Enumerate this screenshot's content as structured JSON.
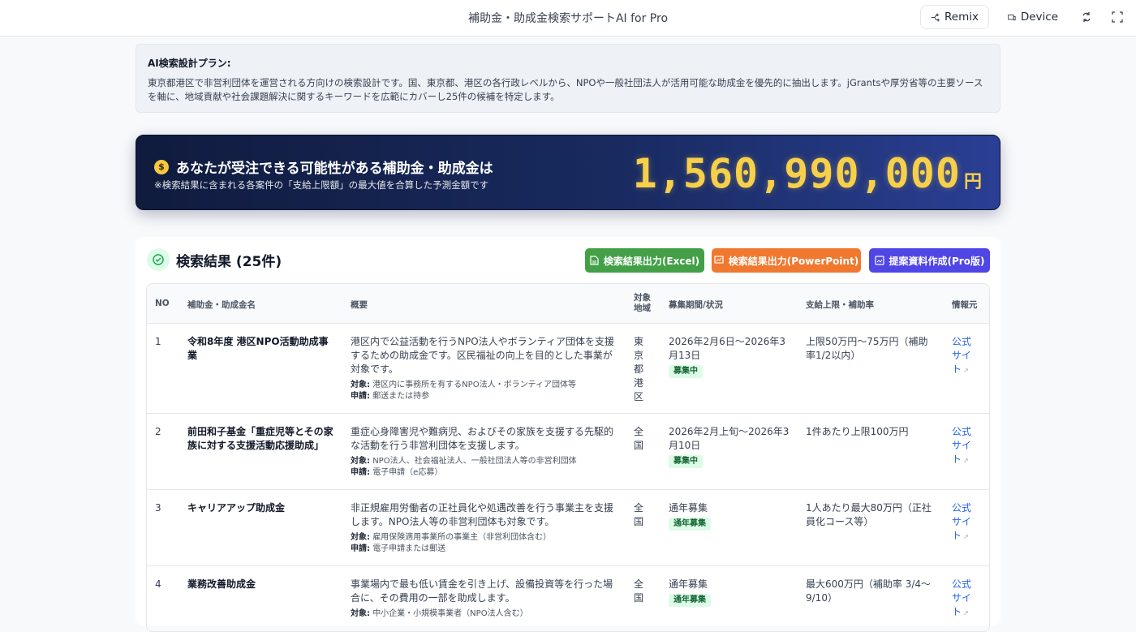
{
  "app": {
    "title": "補助金・助成金検索サポートAI for Pro",
    "remix_label": "Remix",
    "device_label": "Device",
    "icons": [
      "remix-icon",
      "device-icon",
      "refresh-icon",
      "fullscreen-icon"
    ]
  },
  "plan": {
    "title": "AI検索設計プラン:",
    "text": "東京都港区で非営利団体を運営される方向けの検索設計です。国、東京都、港区の各行政レベルから、NPOや一般社団法人が活用可能な助成金を優先的に抽出します。jGrantsや厚労省等の主要ソースを軸に、地域貢献や社会課題解決に関するキーワードを広範にカバーし25件の候補を特定します。"
  },
  "banner": {
    "title": "あなたが受注できる可能性がある補助金・助成金は",
    "subtitle": "※検索結果に含まれる各案件の「支給上限額」の最大値を合算した予測金額です",
    "amount": "1,560,990,000",
    "unit": "円",
    "accent_color": "#f7d04a"
  },
  "results": {
    "title": "検索結果 (25件)",
    "buttons": {
      "excel": "検索結果出力(Excel)",
      "ppt": "検索結果出力(PowerPoint)",
      "pro": "提案資料作成(Pro版)"
    },
    "columns": {
      "no": "NO",
      "name": "補助金・助成金名",
      "summary": "概要",
      "area": "対象地域",
      "period": "募集期間/状況",
      "limit": "支給上限・補助率",
      "source": "情報元"
    },
    "rows": [
      {
        "no": "1",
        "name": "令和8年度 港区NPO活動助成事業",
        "summary": "港区内で公益活動を行うNPO法人やボランティア団体を支援するための助成金です。区民福祉の向上を目的とした事業が対象です。",
        "target_label": "対象:",
        "target": "港区内に事務所を有するNPO法人・ボランティア団体等",
        "apply_label": "申請:",
        "apply": "郵送または持参",
        "area": "東京都港区",
        "period": "2026年2月6日〜2026年3月13日",
        "status": "募集中",
        "limit": "上限50万円〜75万円（補助率1/2以内）",
        "source": "公式サイト"
      },
      {
        "no": "2",
        "name": "前田和子基金「重症児等とその家族に対する支援活動応援助成」",
        "summary": "重症心身障害児や難病児、およびその家族を支援する先駆的な活動を行う非営利団体を支援します。",
        "target_label": "対象:",
        "target": "NPO法人、社会福祉法人、一般社団法人等の非営利団体",
        "apply_label": "申請:",
        "apply": "電子申請（e応募）",
        "area": "全国",
        "period": "2026年2月上旬〜2026年3月10日",
        "status": "募集中",
        "limit": "1件あたり上限100万円",
        "source": "公式サイト"
      },
      {
        "no": "3",
        "name": "キャリアアップ助成金",
        "summary": "非正規雇用労働者の正社員化や処遇改善を行う事業主を支援します。NPO法人等の非営利団体も対象です。",
        "target_label": "対象:",
        "target": "雇用保険適用事業所の事業主（非営利団体含む）",
        "apply_label": "申請:",
        "apply": "電子申請または郵送",
        "area": "全国",
        "period": "通年募集",
        "status": "通年募集",
        "limit": "1人あたり最大80万円（正社員化コース等）",
        "source": "公式サイト"
      },
      {
        "no": "4",
        "name": "業務改善助成金",
        "summary": "事業場内で最も低い賃金を引き上げ、設備投資等を行った場合に、その費用の一部を助成します。",
        "target_label": "対象:",
        "target": "中小企業・小規模事業者（NPO法人含む）",
        "apply_label": "",
        "apply": "",
        "area": "全国",
        "period": "通年募集",
        "status": "通年募集",
        "limit": "最大600万円（補助率 3/4〜9/10）",
        "source": "公式サイト"
      }
    ]
  }
}
